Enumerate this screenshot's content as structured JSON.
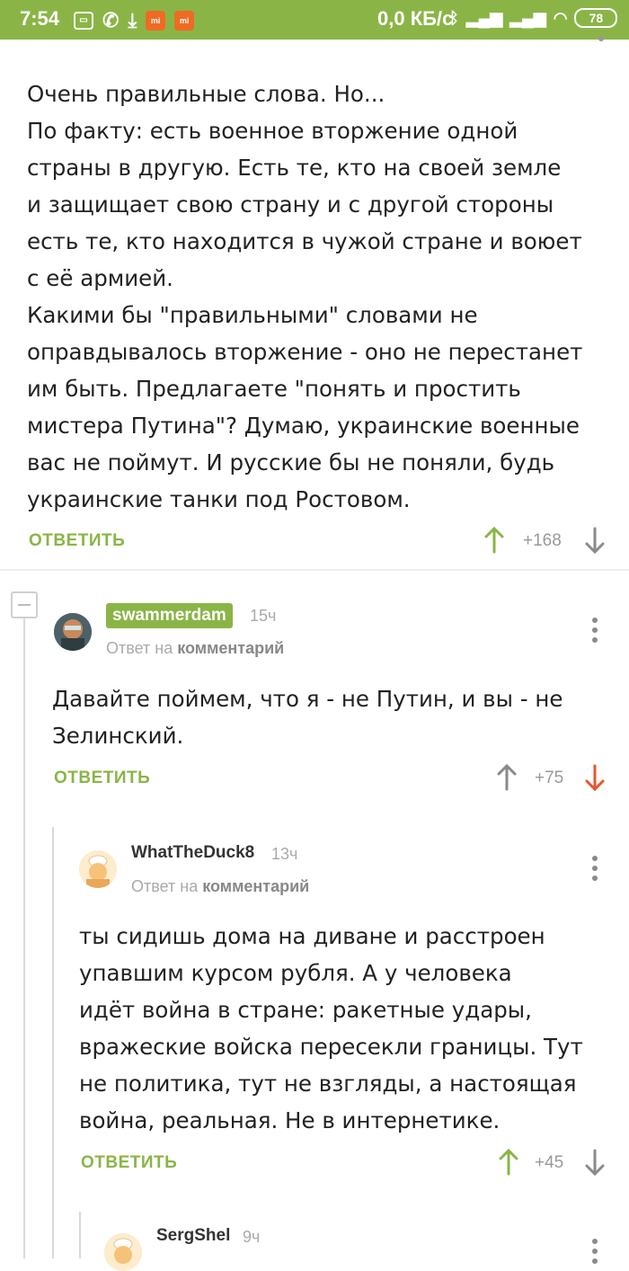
{
  "status_bar": {
    "time": "7:54",
    "speed": "0,0 КБ/с",
    "battery": "78",
    "left_icons": [
      "screen-record-icon",
      "viber-icon",
      "download-icon",
      "mi-app-icon",
      "mi-app-icon"
    ],
    "right_icons": [
      "bluetooth-icon",
      "signal-icon",
      "signal-icon",
      "wifi-icon",
      "battery-icon"
    ]
  },
  "comments": [
    {
      "text": "Очень правильные слова. Но...\nПо факту: есть военное вторжение одной\nстраны в другую. Есть те, кто на своей земле\nи защищает свою страну и с другой стороны\nесть те, кто находится в чужой стране и воюет\nс её армией.\nКакими бы \"правильными\" словами не\nоправдывалось вторжение - оно не перестанет\nим быть. Предлагаете \"понять и простить\nмистера Путина\"? Думаю, украинские военные\nвас не поймут. И русские бы не поняли, будь\nукраинские танки под Ростовом.",
      "reply_label": "ОТВЕТИТЬ",
      "score": "+168"
    },
    {
      "username": "swammerdam",
      "time": "15ч",
      "reply_to_prefix": "Ответ на",
      "reply_to_link": "комментарий",
      "text": "Давайте поймем, что я - не Путин, и вы - не\nЗелинский.",
      "reply_label": "ОТВЕТИТЬ",
      "score": "+75"
    },
    {
      "username": "WhatTheDuck8",
      "time": "13ч",
      "reply_to_prefix": "Ответ на",
      "reply_to_link": "комментарий",
      "text": "ты сидишь дома на диване и расстроен\nупавшим курсом рубля. А у человека\nидёт война в стране: ракетные удары,\nвражеские войска пересекли границы. Тут\nне политика, тут не взгляды, а настоящая\nвойна, реальная. Не в интернетике.",
      "reply_label": "ОТВЕТИТЬ",
      "score": "+45"
    },
    {
      "username": "SergShel",
      "time": "9ч"
    }
  ],
  "colors": {
    "accent": "#8ab546",
    "upvote_active": "#8ab546",
    "downvote_active": "#e4572e",
    "neutral_arrow": "#8a8a8a"
  }
}
